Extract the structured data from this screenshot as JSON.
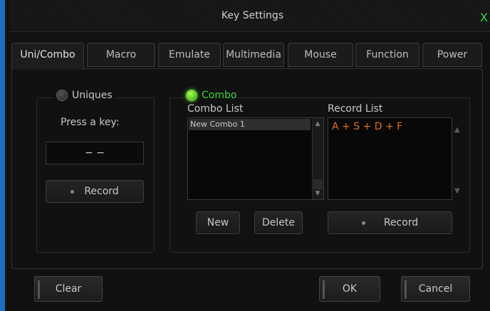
{
  "window": {
    "title": "Key Settings",
    "close_label": "X"
  },
  "tabs": [
    {
      "label": "Uni/Combo",
      "active": true
    },
    {
      "label": "Macro"
    },
    {
      "label": "Emulate"
    },
    {
      "label": "Multimedia"
    },
    {
      "label": "Mouse"
    },
    {
      "label": "Function"
    },
    {
      "label": "Power"
    }
  ],
  "uniques": {
    "radio_label": "Uniques",
    "prompt": "Press a key:",
    "key_value": "− −",
    "record_label": "Record"
  },
  "combo": {
    "radio_label": "Combo",
    "combo_list_label": "Combo List",
    "combo_items": [
      "New Combo 1"
    ],
    "record_list_label": "Record List",
    "record_items": [
      "A + S + D + F"
    ],
    "new_label": "New",
    "delete_label": "Delete",
    "record_label": "Record"
  },
  "footer": {
    "clear_label": "Clear",
    "ok_label": "OK",
    "cancel_label": "Cancel"
  },
  "colors": {
    "accent_green": "#3cd63c",
    "record_text": "#e0701f",
    "window_edge": "#1d6fc4"
  },
  "icons": {
    "close": "close-icon",
    "scroll_up": "scroll-up-arrow-icon",
    "scroll_down": "scroll-down-arrow-icon"
  }
}
